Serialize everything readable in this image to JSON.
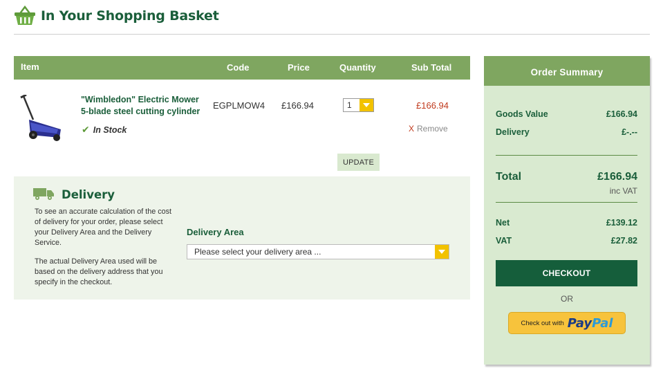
{
  "header": {
    "title": "In Your Shopping Basket"
  },
  "table": {
    "headers": {
      "item": "Item",
      "code": "Code",
      "price": "Price",
      "quantity": "Quantity",
      "subtotal": "Sub Total"
    },
    "item": {
      "name_line1": "\"Wimbledon\" Electric Mower",
      "name_line2": "5-blade steel cutting cylinder",
      "stock": "In Stock",
      "code": "EGPLMOW4",
      "price": "£166.94",
      "quantity": "1",
      "subtotal": "£166.94",
      "remove_label": "Remove",
      "remove_mark": "X"
    },
    "update_label": "UPDATE"
  },
  "delivery": {
    "title": "Delivery",
    "text1": "To see an accurate calculation of the cost of delivery for your order, please select your Delivery Area and the Delivery Service.",
    "text2": "The actual Delivery Area used will be based on the delivery address that you specify in the checkout.",
    "area_label": "Delivery Area",
    "area_placeholder": "Please select your delivery area ..."
  },
  "summary": {
    "title": "Order Summary",
    "goods_label": "Goods Value",
    "goods_value": "£166.94",
    "delivery_label": "Delivery",
    "delivery_value": "£-.--",
    "total_label": "Total",
    "total_value": "£166.94",
    "inc_vat": "inc VAT",
    "net_label": "Net",
    "net_value": "£139.12",
    "vat_label": "VAT",
    "vat_value": "£27.82",
    "checkout_label": "CHECKOUT",
    "or_text": "OR",
    "paypal_pre": "Check out with",
    "paypal_pay": "Pay",
    "paypal_pal": "Pal"
  },
  "colors": {
    "brand_green": "#1a5e3a",
    "header_green": "#7fa660",
    "accent_yellow": "#f2c200",
    "price_red": "#c0391c"
  }
}
